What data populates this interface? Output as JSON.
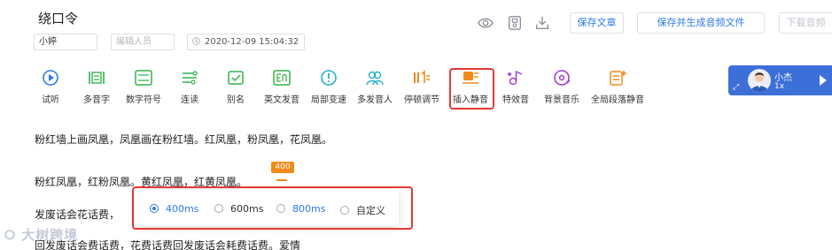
{
  "doc": {
    "title": "绕口令"
  },
  "meta": {
    "speaker_value": "小婷",
    "editor_placeholder": "编辑人员",
    "datetime": "2020-12-09 15:04:32"
  },
  "actions": {
    "save_article": "保存文章",
    "save_generate": "保存并生成音频文件",
    "download": "下载音频"
  },
  "toolbar": [
    {
      "name": "tool-listen",
      "icon": "play-circle-icon",
      "label": "试听",
      "color": "#2c7be5"
    },
    {
      "name": "tool-polyphone",
      "icon": "polyphone-icon",
      "label": "多音字",
      "color": "#33b24a"
    },
    {
      "name": "tool-number",
      "icon": "number-icon",
      "label": "数字符号",
      "color": "#33b24a"
    },
    {
      "name": "tool-linking",
      "icon": "linking-icon",
      "label": "连读",
      "color": "#33b24a"
    },
    {
      "name": "tool-alias",
      "icon": "alias-icon",
      "label": "别名",
      "color": "#33b24a"
    },
    {
      "name": "tool-english",
      "icon": "english-icon",
      "label": "英文发音",
      "color": "#33b24a"
    },
    {
      "name": "tool-speed",
      "icon": "speed-icon",
      "label": "局部变速",
      "color": "#23b3c9"
    },
    {
      "name": "tool-multi-speaker",
      "icon": "multi-speaker-icon",
      "label": "多发音人",
      "color": "#23b3c9"
    },
    {
      "name": "tool-pause",
      "icon": "pause-adjust-icon",
      "label": "停顿调节",
      "color": "#f08a1a"
    },
    {
      "name": "tool-insert-silence",
      "icon": "insert-silence-icon",
      "label": "插入静音",
      "color": "#f08a1a"
    },
    {
      "name": "tool-effects",
      "icon": "effects-icon",
      "label": "特效音",
      "color": "#a23fd1"
    },
    {
      "name": "tool-bgm",
      "icon": "bgm-icon",
      "label": "背景音乐",
      "color": "#a23fd1"
    },
    {
      "name": "tool-global-silence",
      "icon": "global-silence-icon",
      "label": "全局段落静音",
      "color": "#f08a1a"
    }
  ],
  "voice": {
    "name": "小杰",
    "speed": "1x"
  },
  "content": {
    "line1": "粉红墙上画凤凰，凤凰画在粉红墙。红凤凰，粉凤凰，花凤凰。",
    "line2": "粉红凤凰，红粉凤凰。黄红凤凰，红黄凤凰。",
    "line3a": "发废话会花话费，",
    "line3b": "回发废话会费话费，花费话费回发废话会耗费话费。爱情"
  },
  "silence_tag": "400",
  "silence_options": [
    {
      "label": "400ms",
      "selected": true
    },
    {
      "label": "600ms",
      "selected": false
    },
    {
      "label": "800ms",
      "selected": false,
      "highlight": true
    },
    {
      "label": "自定义",
      "selected": false
    }
  ],
  "watermark": "大树跨境"
}
